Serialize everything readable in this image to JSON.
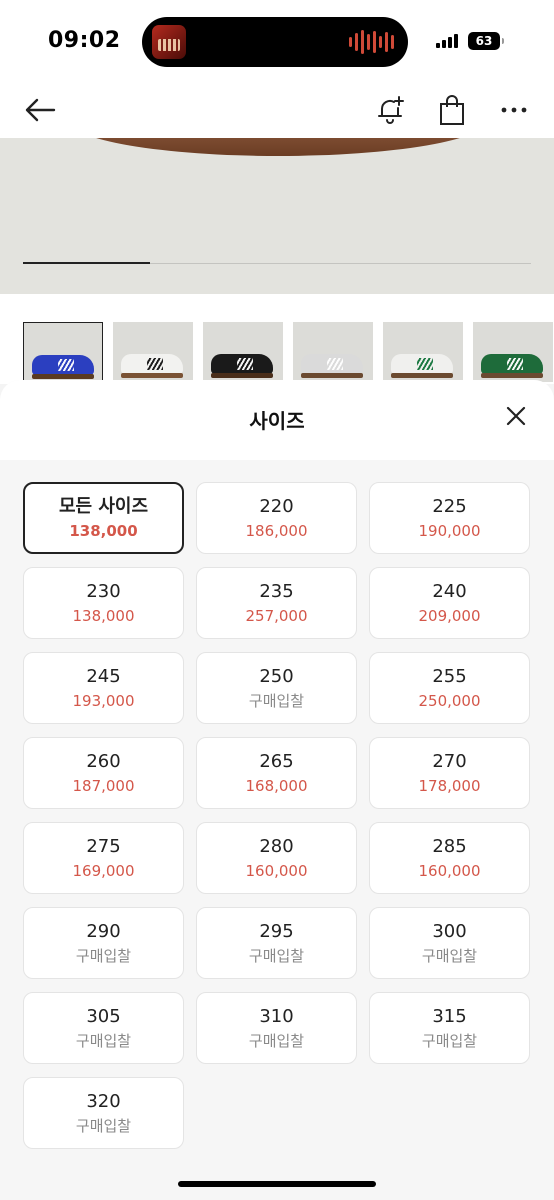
{
  "status_bar": {
    "time": "09:02",
    "battery": "63"
  },
  "header": {
    "icons": [
      "back-arrow-icon",
      "bell-plus-icon",
      "shopping-bag-icon",
      "more-icon"
    ]
  },
  "gallery": {
    "progress": 0.25
  },
  "thumbnails": [
    {
      "upper": "#2b3fc0",
      "sole": "#5a3a20",
      "stripes": "light",
      "selected": true
    },
    {
      "upper": "#f2f2f0",
      "sole": "#7a5234",
      "stripes": "dark",
      "selected": false
    },
    {
      "upper": "#1a1a1a",
      "sole": "#4a2e1a",
      "stripes": "light",
      "selected": false
    },
    {
      "upper": "#dadada",
      "sole": "#6b4a30",
      "stripes": "light",
      "selected": false
    },
    {
      "upper": "#f0f0ee",
      "sole": "#6b4a30",
      "stripes": "green",
      "selected": false
    },
    {
      "upper": "#1e6b3a",
      "sole": "#6b4a30",
      "stripes": "light",
      "selected": false
    }
  ],
  "size_sheet": {
    "title": "사이즈",
    "sizes": [
      {
        "size": "모든 사이즈",
        "price": "138,000",
        "selected": true
      },
      {
        "size": "220",
        "price": "186,000"
      },
      {
        "size": "225",
        "price": "190,000"
      },
      {
        "size": "230",
        "price": "138,000"
      },
      {
        "size": "235",
        "price": "257,000"
      },
      {
        "size": "240",
        "price": "209,000"
      },
      {
        "size": "245",
        "price": "193,000"
      },
      {
        "size": "250",
        "price": "구매입찰",
        "bid": true
      },
      {
        "size": "255",
        "price": "250,000"
      },
      {
        "size": "260",
        "price": "187,000"
      },
      {
        "size": "265",
        "price": "168,000"
      },
      {
        "size": "270",
        "price": "178,000"
      },
      {
        "size": "275",
        "price": "169,000"
      },
      {
        "size": "280",
        "price": "160,000"
      },
      {
        "size": "285",
        "price": "160,000"
      },
      {
        "size": "290",
        "price": "구매입찰",
        "bid": true
      },
      {
        "size": "295",
        "price": "구매입찰",
        "bid": true
      },
      {
        "size": "300",
        "price": "구매입찰",
        "bid": true
      },
      {
        "size": "305",
        "price": "구매입찰",
        "bid": true
      },
      {
        "size": "310",
        "price": "구매입찰",
        "bid": true
      },
      {
        "size": "315",
        "price": "구매입찰",
        "bid": true
      },
      {
        "size": "320",
        "price": "구매입찰",
        "bid": true
      }
    ]
  },
  "colors": {
    "price": "#d4574a",
    "bid": "#8a8a8a",
    "selected_border": "#222222"
  }
}
